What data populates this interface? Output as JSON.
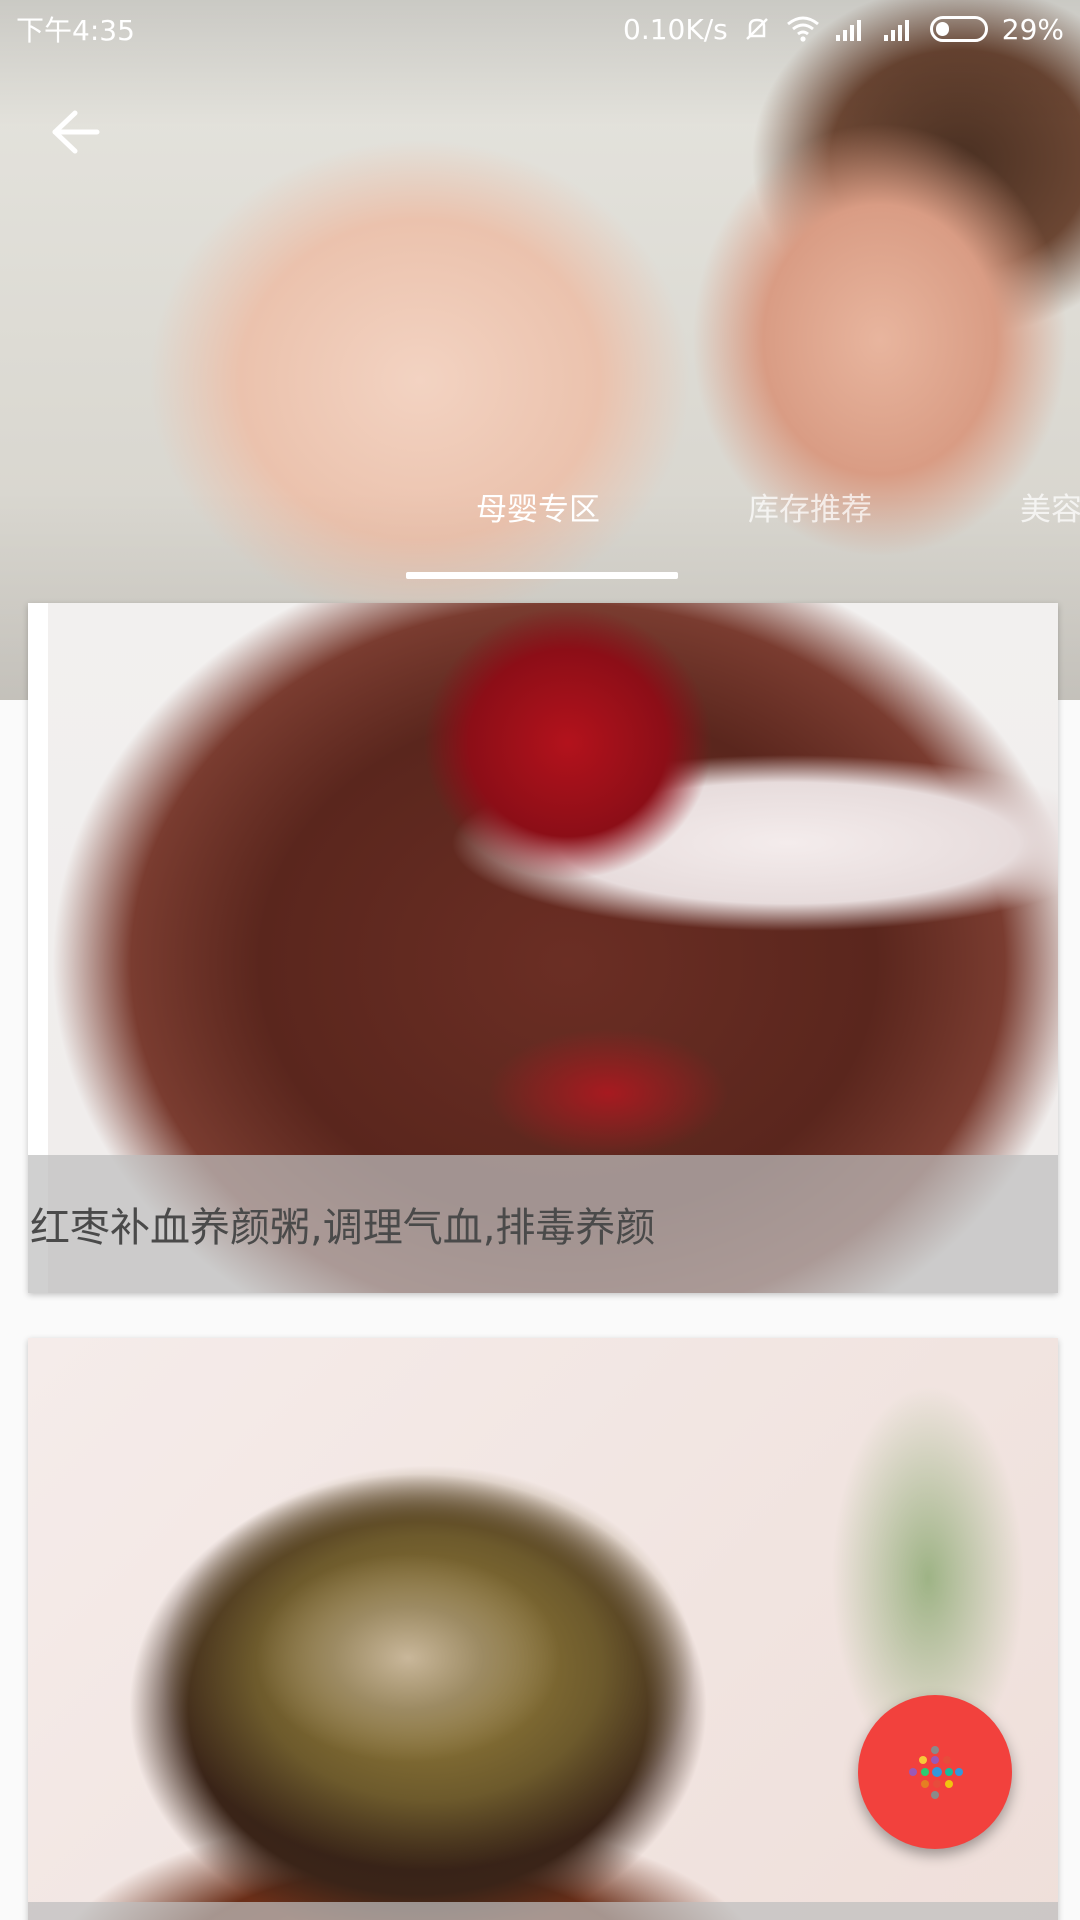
{
  "status_bar": {
    "time": "下午4:35",
    "network_speed": "0.10K/s",
    "battery": "29%",
    "battery_level": 0.29
  },
  "header": {
    "tabs": [
      {
        "label": "母婴专区",
        "active": true
      },
      {
        "label": "库存推荐",
        "active": false
      },
      {
        "label": "美容",
        "active": false
      }
    ]
  },
  "cards": [
    {
      "caption": "红枣补血养颜粥,调理气血,排毒养颜"
    },
    {
      "caption": ""
    }
  ],
  "icons": {
    "back": "arrow-left-icon",
    "fab": "dots-icon"
  },
  "colors": {
    "fab": "#f2413d",
    "caption_bg": "#bebebe",
    "caption_text": "#4a4a4a"
  }
}
